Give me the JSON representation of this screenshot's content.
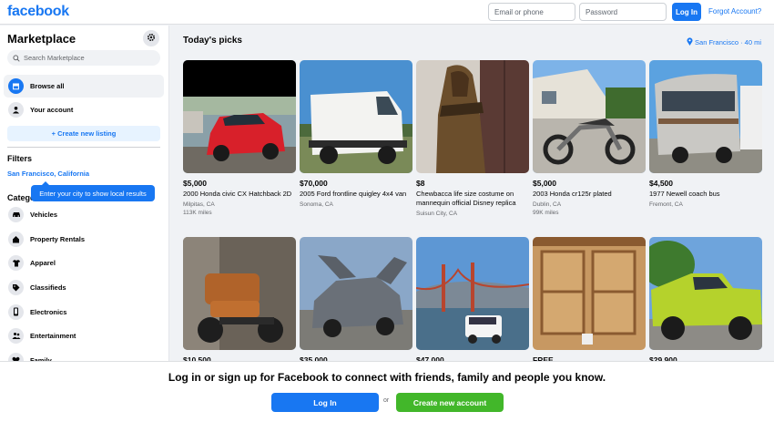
{
  "header": {
    "logo": "facebook",
    "email_placeholder": "Email or phone",
    "password_placeholder": "Password",
    "login_label": "Log In",
    "forgot_label": "Forgot Account?"
  },
  "sidebar": {
    "title": "Marketplace",
    "search_placeholder": "Search Marketplace",
    "nav": [
      {
        "label": "Browse all",
        "icon": "storefront-icon",
        "active": true
      },
      {
        "label": "Your account",
        "icon": "person-icon",
        "active": false
      }
    ],
    "create_listing": "+ Create new listing",
    "filters_title": "Filters",
    "location": "San Francisco, California",
    "tooltip": "Enter your city to show local results",
    "categories_title": "Categories",
    "categories": [
      {
        "label": "Vehicles",
        "icon": "car-icon"
      },
      {
        "label": "Property Rentals",
        "icon": "house-icon"
      },
      {
        "label": "Apparel",
        "icon": "shirt-icon"
      },
      {
        "label": "Classifieds",
        "icon": "tag-icon"
      },
      {
        "label": "Electronics",
        "icon": "phone-icon"
      },
      {
        "label": "Entertainment",
        "icon": "people-icon"
      },
      {
        "label": "Family",
        "icon": "heart-icon"
      }
    ]
  },
  "main": {
    "title": "Today's picks",
    "location": "San Francisco · 40 mi",
    "listings": [
      {
        "price": "$5,000",
        "title": "2000 Honda civic CX Hatchback 2D",
        "location": "Milpitas, CA",
        "miles": "113K miles"
      },
      {
        "price": "$70,000",
        "title": "2005 Ford frontline quigley 4x4 van",
        "location": "Sonoma, CA",
        "miles": ""
      },
      {
        "price": "$8",
        "title": "Chewbacca life size costume on mannequin official Disney replica",
        "location": "Suisun City, CA",
        "miles": ""
      },
      {
        "price": "$5,000",
        "title": "2003 Honda cr125r plated",
        "location": "Dublin, CA",
        "miles": "99K miles"
      },
      {
        "price": "$4,500",
        "title": "1977 Newell coach bus",
        "location": "Fremont, CA",
        "miles": ""
      },
      {
        "price": "$10,500",
        "title": "",
        "location": "",
        "miles": ""
      },
      {
        "price": "$35,000",
        "title": "",
        "location": "",
        "miles": ""
      },
      {
        "price": "$47,000",
        "title": "",
        "location": "",
        "miles": ""
      },
      {
        "price": "FREE",
        "title": "",
        "location": "",
        "miles": ""
      },
      {
        "price": "$29,900",
        "title": "",
        "location": "",
        "miles": ""
      }
    ]
  },
  "banner": {
    "text": "Log in or sign up for Facebook to connect with friends, family and people you know.",
    "login_label": "Log In",
    "or_label": "or",
    "create_label": "Create new account"
  },
  "colors": {
    "brand": "#1877f2",
    "green": "#42b72a"
  }
}
